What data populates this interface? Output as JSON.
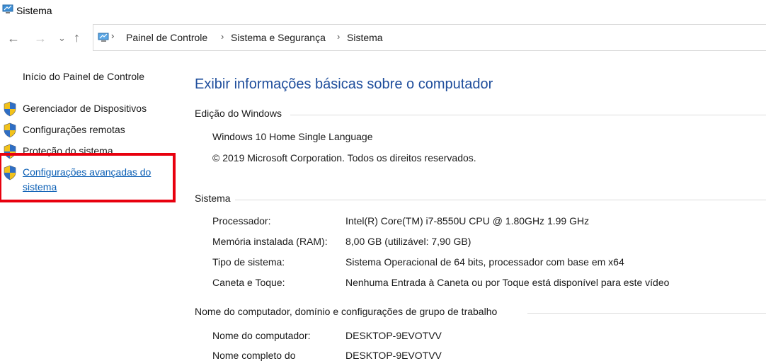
{
  "window": {
    "title": "Sistema"
  },
  "nav": {
    "back": "←",
    "forward": "→",
    "recent": "⌄",
    "up": "↑"
  },
  "breadcrumb": [
    "Painel de Controle",
    "Sistema e Segurança",
    "Sistema"
  ],
  "sidebar": {
    "home": "Início do Painel de Controle",
    "items": [
      {
        "label": "Gerenciador de Dispositivos",
        "icon": "shield-icon"
      },
      {
        "label": "Configurações remotas",
        "icon": "shield-icon"
      },
      {
        "label": "Proteção do sistema",
        "icon": "shield-icon"
      },
      {
        "label": "Configurações avançadas do sistema",
        "icon": "shield-icon",
        "highlighted": true
      }
    ]
  },
  "main": {
    "heading": "Exibir informações básicas sobre o computador",
    "windows_edition": {
      "title": "Edição do Windows",
      "edition": "Windows 10 Home Single Language",
      "copyright": "© 2019 Microsoft Corporation. Todos os direitos reservados."
    },
    "system": {
      "title": "Sistema",
      "rows": [
        {
          "label": "Processador:",
          "value": "Intel(R) Core(TM) i7-8550U CPU @ 1.80GHz   1.99 GHz"
        },
        {
          "label": "Memória instalada (RAM):",
          "value": "8,00 GB (utilizável: 7,90 GB)"
        },
        {
          "label": "Tipo de sistema:",
          "value": "Sistema Operacional de 64 bits, processador com base em x64"
        },
        {
          "label": "Caneta e Toque:",
          "value": "Nenhuma Entrada à Caneta ou por Toque está disponível para este vídeo"
        }
      ]
    },
    "computer_name": {
      "title": "Nome do computador, domínio e configurações de grupo de trabalho",
      "rows": [
        {
          "label": "Nome do computador:",
          "value": "DESKTOP-9EVOTVV"
        },
        {
          "label": "Nome completo do",
          "value": "DESKTOP-9EVOTVV"
        }
      ]
    }
  },
  "colors": {
    "heading": "#1f4e9c",
    "link": "#0b5fb5",
    "highlight": "#e8000e"
  }
}
